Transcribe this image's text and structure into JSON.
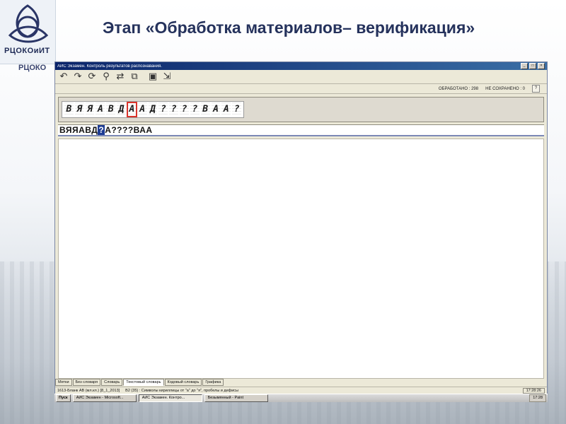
{
  "logo": {
    "text": "РЦОКОиИТ",
    "text_repeat": "РЦОКО"
  },
  "slide": {
    "title": "Этап «Обработка материалов– верификация»"
  },
  "window": {
    "title": "АИС Экзамен. Контроль результатов распознавания.",
    "controls": {
      "minimize": "_",
      "maximize": "□",
      "close": "×"
    }
  },
  "toolbar": {
    "icons": [
      "undo-icon",
      "redo-icon",
      "rotate-icon",
      "zoom-icon",
      "move-icon",
      "copy-icon",
      "save-icon",
      "export-icon"
    ]
  },
  "status": {
    "processed_label": "ОБРАБОТАНО : 298",
    "unsaved_label": "НЕ СОХРАНЕНО : 0",
    "help": "?"
  },
  "scan": {
    "glyphs": [
      "В",
      "Я",
      "Я",
      "А",
      "В",
      "Д",
      "А",
      "А",
      "Д",
      "?",
      "?",
      "?",
      "?",
      "В",
      "А",
      "А",
      "?"
    ],
    "selected_index": 6
  },
  "recognized": {
    "before": "ВЯЯАВД",
    "current": "?",
    "after": "А????ВАА"
  },
  "tabs": [
    "Метки",
    "Без словаря",
    "Словарь",
    "Текстовый словарь",
    "Кодовый словарь",
    "Графика"
  ],
  "active_tab": 3,
  "app_status": {
    "left": "1613-Бланк АВ (мл.кл.) [8_1_2013]",
    "middle": "В2 (35) : Символы кириллицы от \"а\" до \"я\", пробелы и дефисы",
    "time": "17:28:26"
  },
  "taskbar": {
    "start": "Пуск",
    "tasks": [
      "АИС Экзамен - Microsoft...",
      "АИС Экзамен. Контро...",
      "Безымянный - Paint"
    ],
    "active_task": 1,
    "clock": "17:28"
  }
}
